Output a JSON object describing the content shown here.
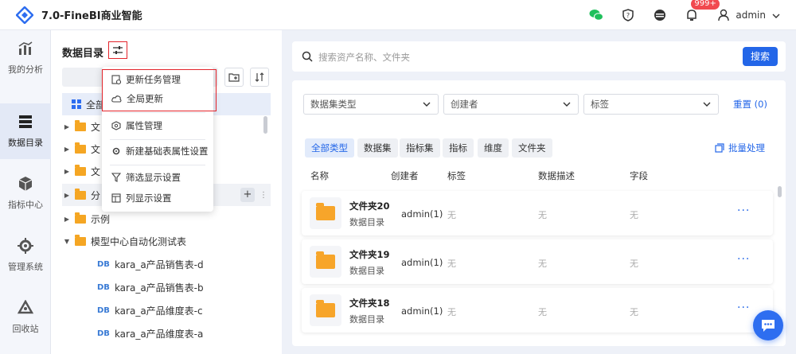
{
  "app": {
    "title": "7.0-FineBI商业智能",
    "logo_icon": "finebi-logo-icon"
  },
  "topbar": {
    "badge": "999+",
    "user": "admin",
    "icons": [
      "wechat-icon",
      "shield-icon",
      "theme-icon",
      "bell-icon",
      "user-icon"
    ]
  },
  "nav": [
    {
      "label": "我的分析",
      "icon": "chart-icon"
    },
    {
      "label": "数据目录",
      "icon": "database-icon",
      "active": true
    },
    {
      "label": "指标中心",
      "icon": "cube-icon"
    },
    {
      "label": "管理系统",
      "icon": "gear-icon"
    },
    {
      "label": "回收站",
      "icon": "recycle-icon"
    }
  ],
  "catalog": {
    "title": "数据目录",
    "tree": [
      {
        "label": "全部",
        "type": "all"
      },
      {
        "label": "文",
        "type": "folder"
      },
      {
        "label": "文",
        "type": "folder"
      },
      {
        "label": "文",
        "type": "folder"
      },
      {
        "label": "分",
        "type": "folder"
      },
      {
        "label": "示例",
        "type": "folder"
      },
      {
        "label": "模型中心自动化测试表",
        "type": "folder-open"
      },
      {
        "label": "kara_a产品销售表-d",
        "type": "db"
      },
      {
        "label": "kara_a产品销售表-b",
        "type": "db"
      },
      {
        "label": "kara_a产品维度表-c",
        "type": "db"
      },
      {
        "label": "kara_a产品维度表-a",
        "type": "db"
      }
    ],
    "db_tag": "DB"
  },
  "menu": {
    "items": [
      "更新任务管理",
      "全局更新",
      "属性管理",
      "新建基础表属性设置",
      "筛选显示设置",
      "列显示设置"
    ]
  },
  "search": {
    "placeholder": "搜索资产名称、文件夹",
    "button": "搜索"
  },
  "filters": {
    "dataset_type": "数据集类型",
    "creator": "创建者",
    "tag": "标签",
    "reset": "重置 (0)"
  },
  "type_tabs": [
    "全部类型",
    "数据集",
    "指标集",
    "指标",
    "维度",
    "文件夹"
  ],
  "batch": "批量处理",
  "table": {
    "headers": [
      "名称",
      "创建者",
      "标签",
      "数据描述",
      "字段"
    ],
    "rows": [
      {
        "name": "文件夹20",
        "sub": "数据目录",
        "creator": "admin(1)",
        "tag": "无",
        "desc": "无",
        "field": "无"
      },
      {
        "name": "文件夹19",
        "sub": "数据目录",
        "creator": "admin(1)",
        "tag": "无",
        "desc": "无",
        "field": "无"
      },
      {
        "name": "文件夹18",
        "sub": "数据目录",
        "creator": "admin(1)",
        "tag": "无",
        "desc": "无",
        "field": "无"
      }
    ],
    "more": "···"
  },
  "colors": {
    "accent": "#2366e8",
    "highlight": "#e3242b",
    "folder": "#f5a623"
  }
}
